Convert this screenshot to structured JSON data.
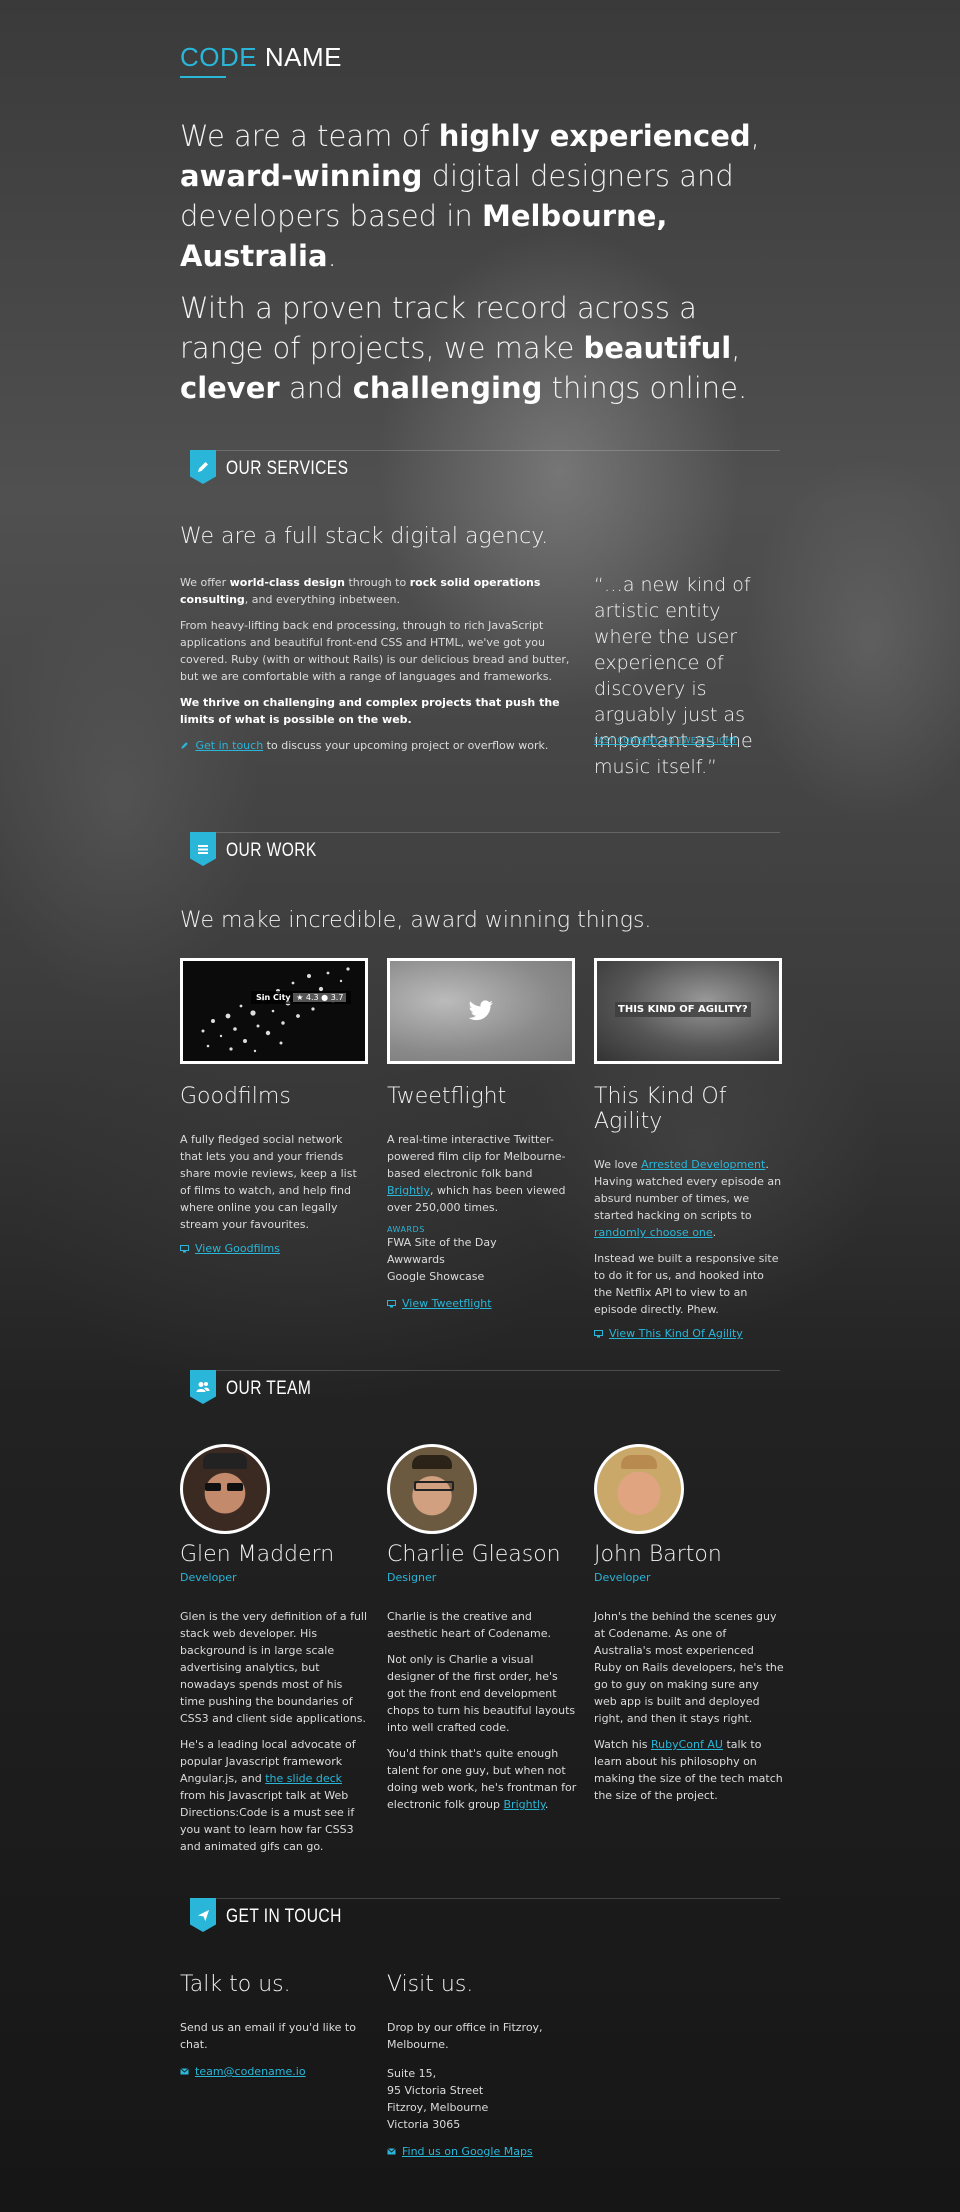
{
  "brand": {
    "code": "CODE",
    "name": "NAME"
  },
  "hero": {
    "p1": {
      "a": "We are a team of ",
      "b1": "highly experienced",
      "c": ", ",
      "b2": "award-winning",
      "d": " digital designers and developers based in ",
      "b3": "Melbourne, Australia",
      "e": "."
    },
    "p2": {
      "a": "With a proven track record across a range of projects, we make ",
      "b1": "beautiful",
      "c": ", ",
      "b2": "clever",
      "d": " and ",
      "b3": "challenging",
      "e": " things online."
    }
  },
  "services": {
    "title": "OUR SERVICES",
    "heading": "We are a full stack digital agency.",
    "p1": {
      "a": "We offer ",
      "b1": "world-class design",
      "c": " through to ",
      "b2": "rock solid operations consulting",
      "d": ", and everything inbetween."
    },
    "p2": "From heavy-lifting back end processing, through to rich JavaScript applications and beautiful front-end CSS and HTML, we've got you covered. Ruby (with or without Rails) is our delicious bread and butter, but we are comfortable with a range of languages and frameworks.",
    "p3": "We thrive on challenging and complex projects that push the limits of what is possible on the web.",
    "cta_link": "Get in touch",
    "cta_rest": " to discuss your upcoming project or overflow work.",
    "quote": "“…a new kind of artistic entity where the user experience of discovery is arguably just as important as the music itself.”",
    "quote_source": "FAST COMPANY ON TWEETFLIGHT"
  },
  "work": {
    "title": "OUR WORK",
    "heading": "We make incredible, award winning things.",
    "projects": [
      {
        "name": "Goodfilms",
        "thumb_title": "Sin City",
        "thumb_rating": "★ 4.3 ● 3.7",
        "desc": "A fully fledged social network that lets you and your friends share movie reviews, keep a list of films to watch, and help find where online you can legally stream your favourites.",
        "link": "View Goodfilms"
      },
      {
        "name": "Tweetflight",
        "desc_a": "A real-time interactive Twitter-powered film clip for Melbourne-based electronic folk band ",
        "desc_link": "Brightly",
        "desc_b": ", which has been viewed over 250,000 times.",
        "awards_label": "AWARDS",
        "awards": [
          "FWA Site of the Day",
          "Awwwards",
          "Google Showcase"
        ],
        "link": "View Tweetflight"
      },
      {
        "name": "This Kind Of Agility",
        "thumb_title": "THIS KIND OF AGILITY?",
        "p1_a": "We love ",
        "p1_link1": "Arrested Development",
        "p1_b": ". Having watched every episode an absurd number of times, we started hacking on scripts to ",
        "p1_link2": "randomly choose one",
        "p1_c": ".",
        "p2": "Instead we built a responsive site to do it for us, and hooked into the Netflix API to view to an episode directly. Phew.",
        "link": "View This Kind Of Agility"
      }
    ]
  },
  "team": {
    "title": "OUR TEAM",
    "members": [
      {
        "name": "Glen Maddern",
        "role": "Developer",
        "p1": "Glen is the very definition of a full stack web developer. His background is in large scale advertising analytics, but nowadays spends most of his time pushing the boundaries of CSS3 and client side applications.",
        "p2_a": "He's a leading local advocate of popular Javascript framework Angular.js, and ",
        "p2_link": "the slide deck",
        "p2_b": " from his Javascript talk at Web Directions:Code is a must see if you want to learn how far CSS3 and animated gifs can go."
      },
      {
        "name": "Charlie Gleason",
        "role": "Designer",
        "p1": "Charlie is the creative and aesthetic heart of Codename.",
        "p2": "Not only is Charlie a visual designer of the first order, he's got the front end development chops to turn his beautiful layouts into well crafted code.",
        "p3_a": "You'd think that's quite enough talent for one guy, but when not doing web work, he's frontman for electronic folk group ",
        "p3_link": "Brightly",
        "p3_b": "."
      },
      {
        "name": "John Barton",
        "role": "Developer",
        "p1": "John's the behind the scenes guy at Codename. As one of Australia's most experienced Ruby on Rails developers, he's the go to guy on making sure any web app is built and deployed right, and then it stays right.",
        "p2_a": "Watch his ",
        "p2_link": "RubyConf AU",
        "p2_b": " talk to learn about his philosophy on making the size of the tech match the size of the project."
      }
    ]
  },
  "contact": {
    "title": "GET IN TOUCH",
    "talk_heading": "Talk to us.",
    "talk_text": "Send us an email if you'd like to chat.",
    "email": "team@codename.io",
    "visit_heading": "Visit us.",
    "visit_text": "Drop by our office in Fitzroy, Melbourne.",
    "address": [
      "Suite 15,",
      "95 Victoria Street",
      "Fitzroy, Melbourne",
      "Victoria 3065"
    ],
    "map_link": "Find us on Google Maps"
  },
  "colors": {
    "accent": "#29b6d9",
    "text": "#f2f2f2",
    "background": "#262626"
  }
}
